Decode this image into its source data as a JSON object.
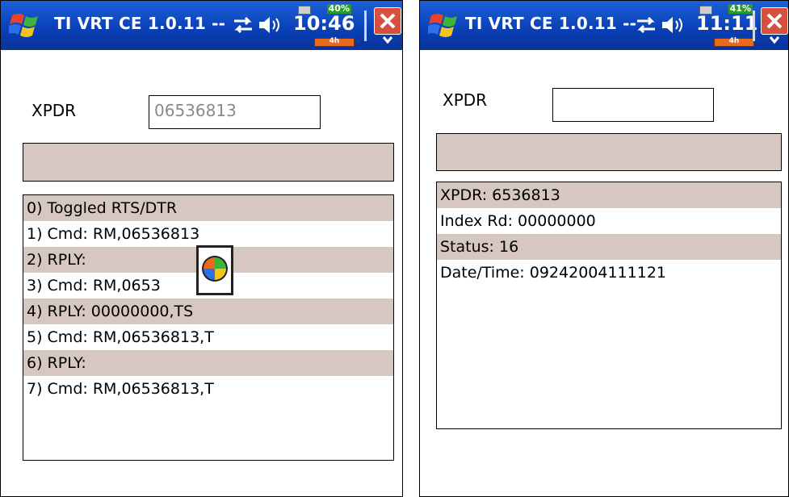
{
  "left": {
    "titlebar": {
      "title": "TI VRT CE 1.0.11 --",
      "clock": "10:46",
      "battery_percent": "40%",
      "signal_label": "4h"
    },
    "xpdr_label": "XPDR",
    "xpdr_value": "06536813",
    "rows": [
      "0) Toggled RTS/DTR",
      "1) Cmd: RM,06536813",
      "2) RPLY:",
      "3) Cmd: RM,0653",
      "4) RPLY: 00000000,TS",
      "5) Cmd: RM,06536813,T",
      "6) RPLY:",
      "7) Cmd: RM,06536813,T"
    ]
  },
  "right": {
    "titlebar": {
      "title": "TI VRT CE 1.0.11 --",
      "clock": "11:11",
      "battery_percent": "41%",
      "signal_label": "4h"
    },
    "xpdr_label": "XPDR",
    "xpdr_value": "",
    "rows": [
      "XPDR: 6536813",
      "Index Rd: 00000000",
      "Status: 16",
      "Date/Time: 09242004111121"
    ]
  },
  "icons": {
    "start": "windows-flag-icon",
    "sync": "sync-arrows-icon",
    "volume": "speaker-icon",
    "close": "close-x-icon",
    "menu": "chevron-down-icon",
    "busy": "busy-wait-icon"
  },
  "colors": {
    "titlebar": "#0a3fb5",
    "row_shade": "#d6c8c0",
    "close": "#d65040"
  }
}
